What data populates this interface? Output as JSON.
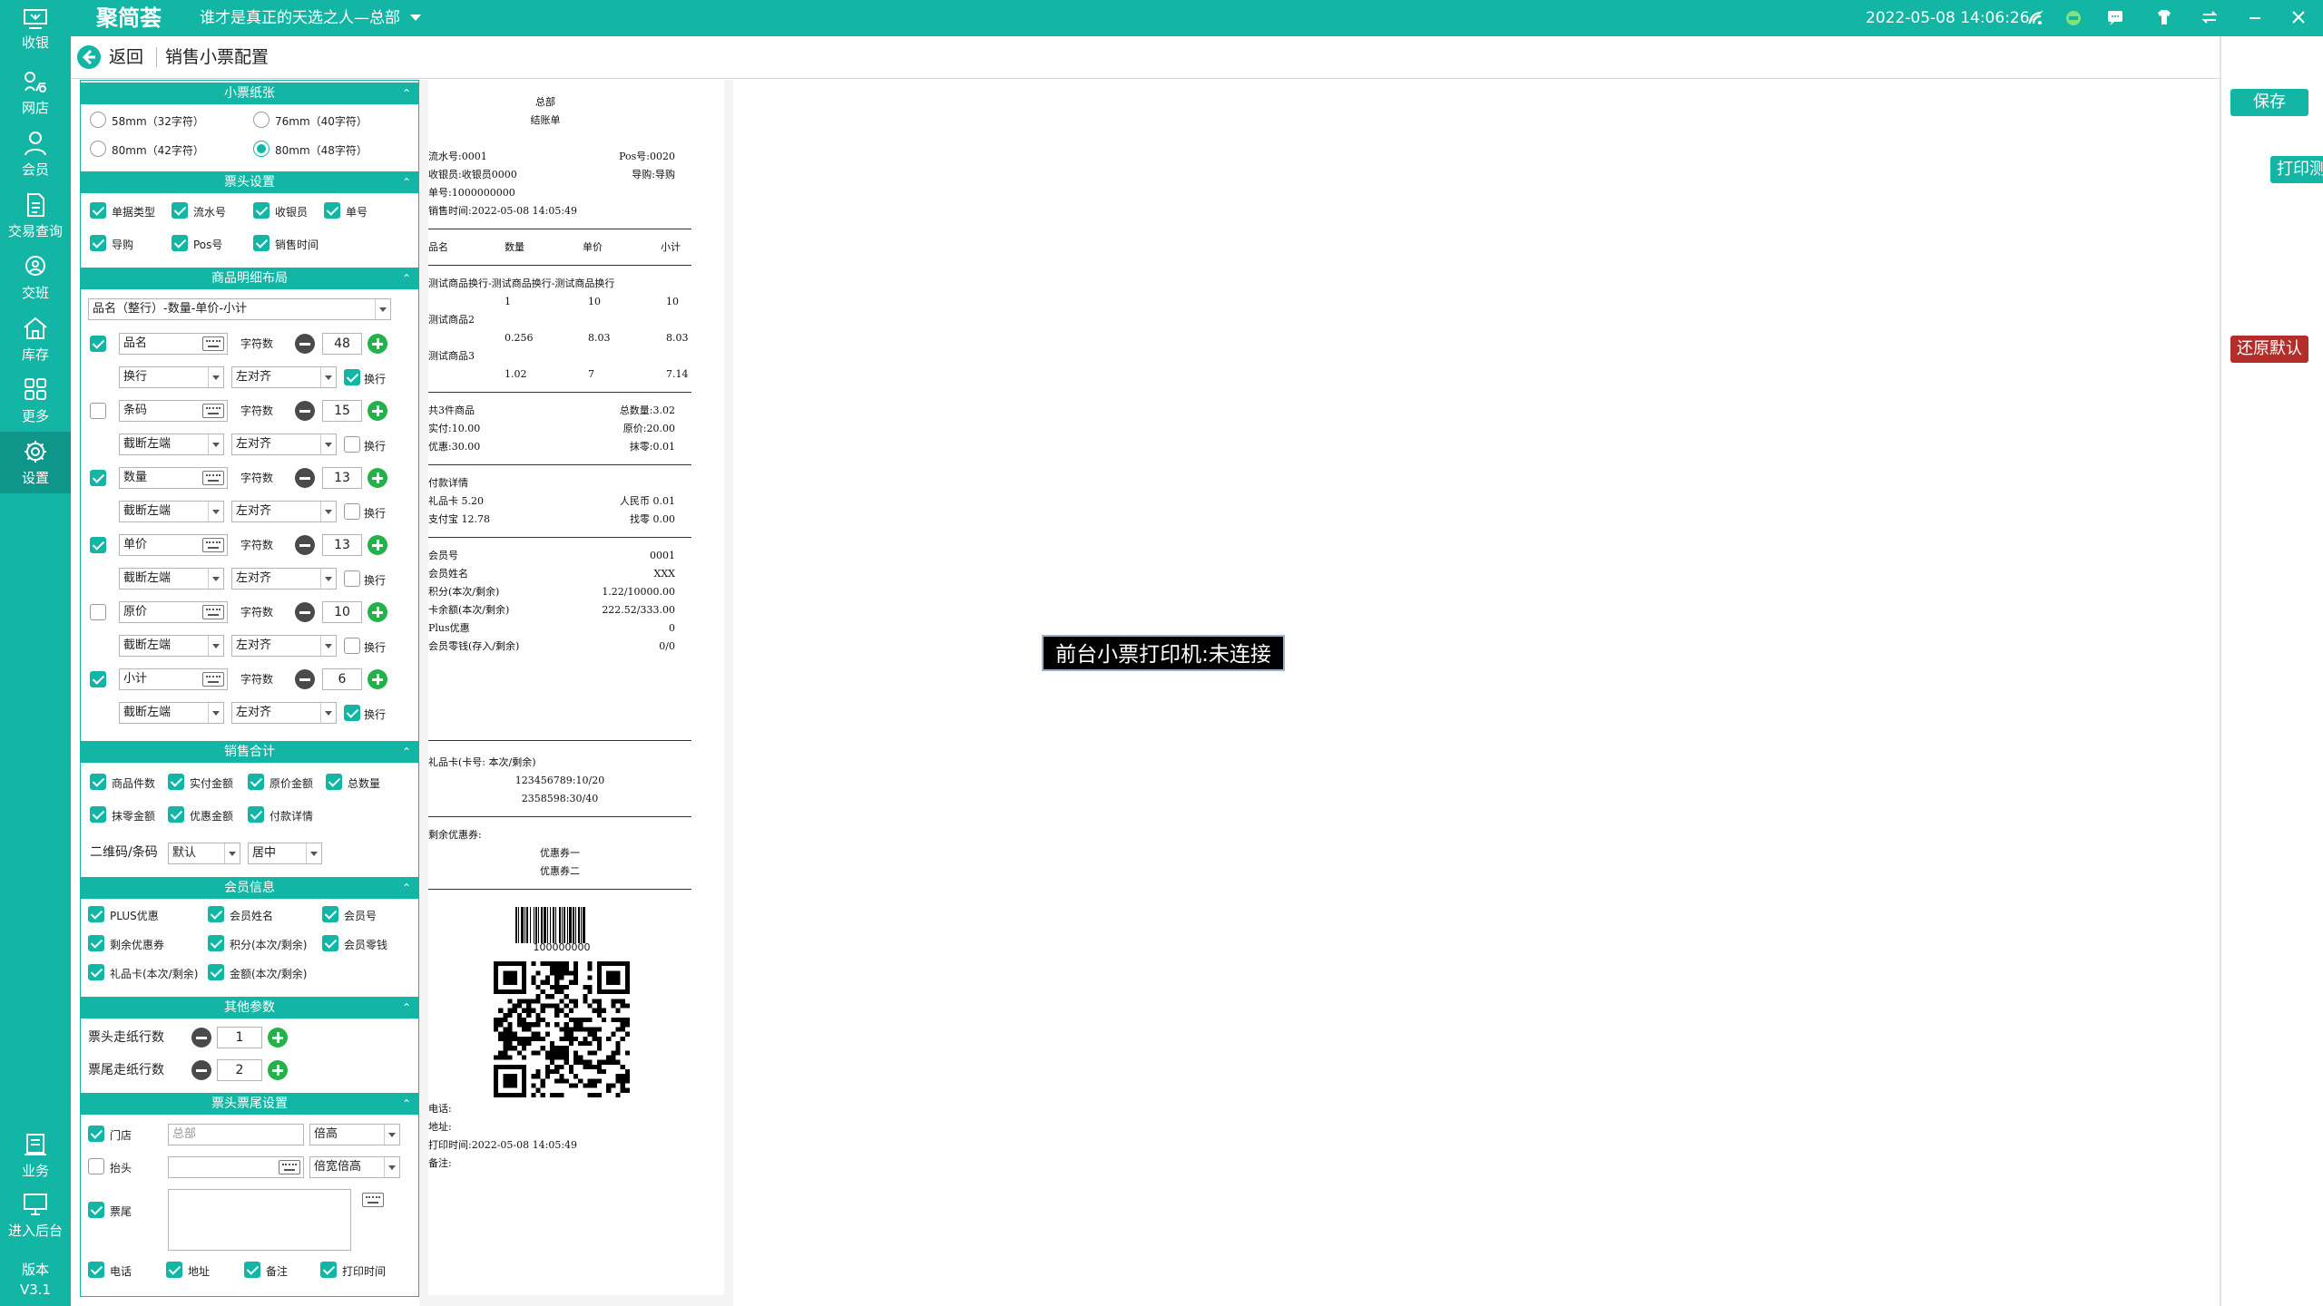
{
  "topbar": {
    "logo": "聚简荟",
    "store": "谁才是真正的天选之人—总部",
    "datetime": "2022-05-08 14:06:26"
  },
  "sidebar": {
    "items": [
      {
        "label": "收银",
        "icon": "cashier-icon"
      },
      {
        "label": "网店",
        "icon": "shop-icon"
      },
      {
        "label": "会员",
        "icon": "member-icon"
      },
      {
        "label": "交易查询",
        "icon": "document-icon"
      },
      {
        "label": "交班",
        "icon": "handover-icon"
      },
      {
        "label": "库存",
        "icon": "home-icon"
      },
      {
        "label": "更多",
        "icon": "grid-icon"
      },
      {
        "label": "设置",
        "icon": "gear-icon"
      }
    ],
    "bottom": [
      {
        "label": "业务",
        "icon": "business-icon"
      },
      {
        "label": "进入后台",
        "icon": "monitor-icon"
      }
    ],
    "version_label": "版本",
    "version": "V3.1"
  },
  "header": {
    "back": "返回",
    "title": "销售小票配置"
  },
  "paper": {
    "title": "小票纸张",
    "options": [
      "58mm（32字符）",
      "76mm（40字符）",
      "80mm（42字符）",
      "80mm（48字符）"
    ],
    "selected": 3
  },
  "ticket_head": {
    "title": "票头设置",
    "items": [
      "单据类型",
      "流水号",
      "收银员",
      "单号",
      "导购",
      "Pos号",
      "销售时间"
    ]
  },
  "detail": {
    "title": "商品明细布局",
    "layout": "品名（整行）-数量-单价-小计",
    "char_label": "字符数",
    "wrap_label": "换行",
    "rows": [
      {
        "name": "品名",
        "checked": true,
        "count": "48",
        "mode": "换行",
        "align": "左对齐",
        "wrap": true
      },
      {
        "name": "条码",
        "checked": false,
        "count": "15",
        "mode": "截断左端",
        "align": "左对齐",
        "wrap": false
      },
      {
        "name": "数量",
        "checked": true,
        "count": "13",
        "mode": "截断左端",
        "align": "左对齐",
        "wrap": false
      },
      {
        "name": "单价",
        "checked": true,
        "count": "13",
        "mode": "截断左端",
        "align": "左对齐",
        "wrap": false
      },
      {
        "name": "原价",
        "checked": false,
        "count": "10",
        "mode": "截断左端",
        "align": "左对齐",
        "wrap": false
      },
      {
        "name": "小计",
        "checked": true,
        "count": "6",
        "mode": "截断左端",
        "align": "左对齐",
        "wrap": true
      }
    ]
  },
  "sales_total": {
    "title": "销售合计",
    "items": [
      "商品件数",
      "实付金额",
      "原价金额",
      "总数量",
      "抹零金额",
      "优惠金额",
      "付款详情"
    ],
    "code_label": "二维码/条码",
    "code_value": "默认",
    "code_align": "居中"
  },
  "member": {
    "title": "会员信息",
    "items": [
      "PLUS优惠",
      "会员姓名",
      "会员号",
      "剩余优惠券",
      "积分(本次/剩余)",
      "会员零钱",
      "礼品卡(本次/剩余)",
      "金额(本次/剩余)"
    ]
  },
  "other": {
    "title": "其他参数",
    "head_label": "票头走纸行数",
    "head_value": "1",
    "tail_label": "票尾走纸行数",
    "tail_value": "2"
  },
  "headtail": {
    "title": "票头票尾设置",
    "store_label": "门店",
    "store_placeholder": "总部",
    "store_size": "倍高",
    "head_label": "抬头",
    "head_size": "倍宽倍高",
    "tail_label": "票尾",
    "bottom": [
      "电话",
      "地址",
      "备注",
      "打印时间"
    ]
  },
  "receipt": {
    "store": "总部",
    "doc_type": "结账单",
    "serial": "流水号:0001",
    "pos": "Pos号:0020",
    "cashier": "收银员:收银员0000",
    "guide": "导购:导购",
    "order_no": "单号:1000000000",
    "sale_time": "销售时间:2022-05-08 14:05:49",
    "columns": [
      "品名",
      "数量",
      "单价",
      "小计"
    ],
    "items": [
      {
        "name": "测试商品换行-测试商品换行-测试商品换行",
        "qty": "1",
        "price": "10",
        "subtotal": "10"
      },
      {
        "name": "测试商品2",
        "qty": "0.256",
        "price": "8.03",
        "subtotal": "8.03"
      },
      {
        "name": "测试商品3",
        "qty": "1.02",
        "price": "7",
        "subtotal": "7.14"
      }
    ],
    "totals": [
      [
        "共3件商品",
        "总数量:3.02"
      ],
      [
        "实付:10.00",
        "原价:20.00"
      ],
      [
        "优惠:30.00",
        "抹零:0.01"
      ]
    ],
    "payment_title": "付款详情",
    "payments": [
      [
        "礼品卡 5.20",
        "人民币 0.01"
      ],
      [
        "支付宝 12.78",
        "找零 0.00"
      ]
    ],
    "member_rows": [
      [
        "会员号",
        "0001"
      ],
      [
        "会员姓名",
        "XXX"
      ],
      [
        "积分(本次/剩余)",
        "1.22/10000.00"
      ],
      [
        "卡余额(本次/剩余)",
        "222.52/333.00"
      ],
      [
        "Plus优惠",
        "0"
      ],
      [
        "会员零钱(存入/剩余)",
        "0/0"
      ]
    ],
    "giftcard_title": "礼品卡(卡号: 本次/剩余)",
    "giftcards": [
      "123456789:10/20",
      "2358598:30/40"
    ],
    "coupon_title": "剩余优惠券:",
    "coupons": [
      "优惠券一",
      "优惠券二"
    ],
    "barcode_text": "100000000",
    "phone": "电话:",
    "address": "地址:",
    "print_time": "打印时间:2022-05-08 14:05:49",
    "note": "备注:"
  },
  "actions": {
    "save": "保存",
    "print_test": "打印测试",
    "restore": "还原默认"
  },
  "colors": {
    "primary": "#13b5a5",
    "restore": "#b32d2a",
    "plus": "#23b24a"
  },
  "toast": "前台小票打印机:未连接"
}
